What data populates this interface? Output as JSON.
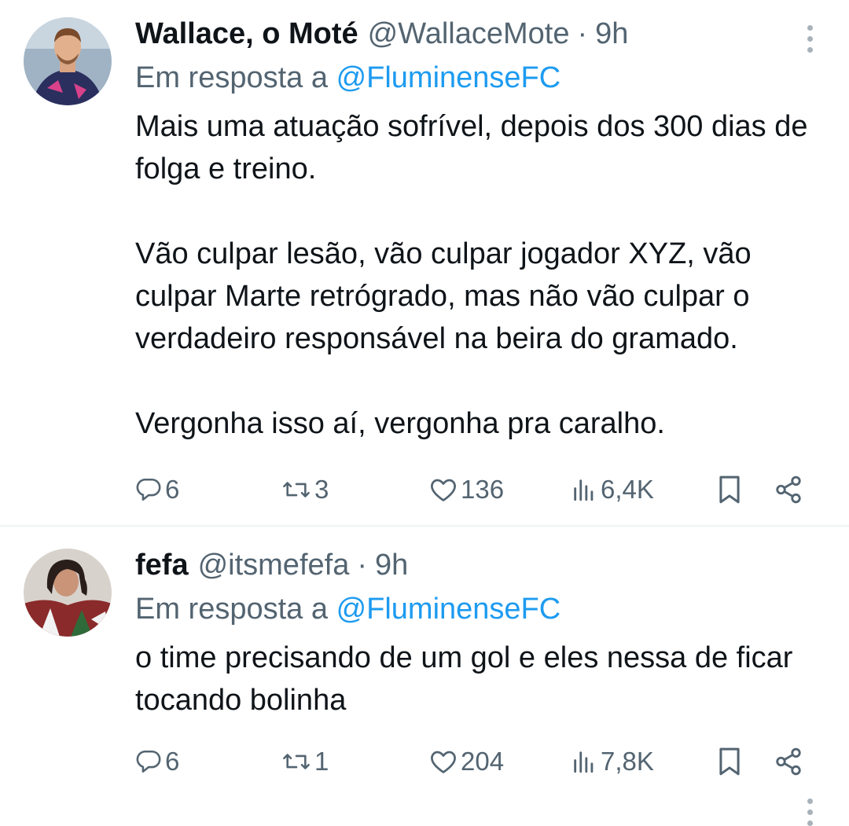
{
  "tweets": [
    {
      "name": "Wallace, o Moté",
      "handle": "@WallaceMote",
      "separator": "·",
      "time": "9h",
      "reply_prefix": "Em resposta a",
      "reply_mention": "@FluminenseFC",
      "paragraphs": [
        "Mais uma atuação sofrível, depois dos 300 dias de folga e treino.",
        "Vão culpar lesão, vão culpar jogador XYZ, vão culpar Marte retrógrado, mas não vão culpar o verdadeiro responsável na beira do gramado.",
        "Vergonha isso aí, vergonha pra caralho."
      ],
      "replies": "6",
      "reposts": "3",
      "likes": "136",
      "views": "6,4K"
    },
    {
      "name": "fefa",
      "handle": "@itsmefefa",
      "separator": "·",
      "time": "9h",
      "reply_prefix": "Em resposta a",
      "reply_mention": "@FluminenseFC",
      "paragraphs": [
        "o time precisando de um gol e eles nessa de ficar tocando bolinha"
      ],
      "replies": "6",
      "reposts": "1",
      "likes": "204",
      "views": "7,8K"
    }
  ],
  "icons": {
    "reply": "reply-icon",
    "repost": "repost-icon",
    "like": "heart-icon",
    "views": "views-icon",
    "bookmark": "bookmark-icon",
    "share": "share-icon",
    "more": "more-vertical-icon"
  },
  "colors": {
    "text": "#0f1419",
    "secondary": "#536471",
    "mention": "#1d9bf0",
    "divider": "#eff3f4"
  }
}
